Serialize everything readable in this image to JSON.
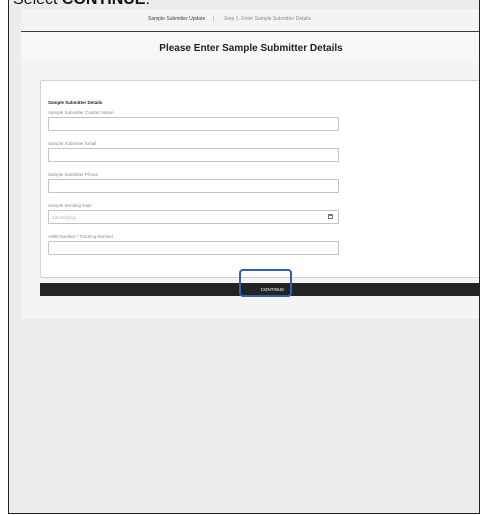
{
  "instruction": {
    "prefix": "Select ",
    "emphasis": "CONTINUE",
    "suffix": "."
  },
  "topbar": {
    "workflow": "Sample Submitter Update",
    "separator": "|",
    "step": "Step 1: Enter Sample Submitter Details"
  },
  "page": {
    "title": "Please Enter Sample Submitter Details"
  },
  "form": {
    "section_title": "Sample Submitter Details",
    "fields": [
      {
        "label": "Sample Submitter Contact Name",
        "value": "",
        "placeholder": ""
      },
      {
        "label": "Sample Submitter Email",
        "value": "",
        "placeholder": ""
      },
      {
        "label": "Sample Submitter Phone",
        "value": "",
        "placeholder": ""
      },
      {
        "label": "Sample Sending Date",
        "value": "",
        "placeholder": "mm/dd/yyyy",
        "icon": "calendar-icon"
      },
      {
        "label": "AWB Number / Tracking Number",
        "value": "",
        "placeholder": ""
      }
    ]
  },
  "actions": {
    "continue_label": "CONTINUE"
  },
  "colors": {
    "highlight": "#2f5fb7",
    "action_bar": "#232323",
    "page_bg": "#ececec"
  }
}
